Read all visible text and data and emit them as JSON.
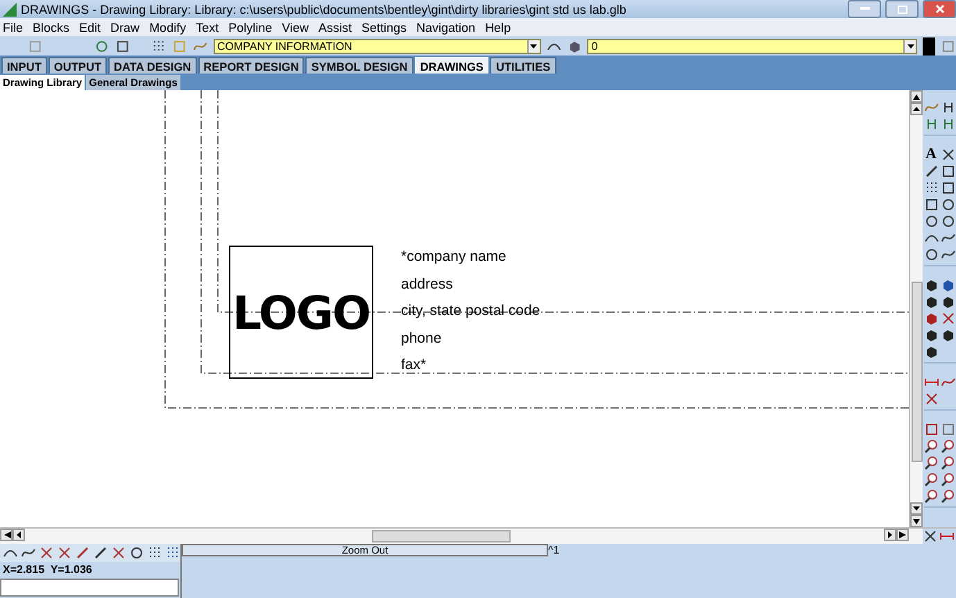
{
  "window": {
    "title": "DRAWINGS -  Drawing Library:  Library: c:\\users\\public\\documents\\bentley\\gint\\dirty libraries\\gint std us lab.glb"
  },
  "menu": [
    "File",
    "Blocks",
    "Edit",
    "Draw",
    "Modify",
    "Text",
    "Polyline",
    "View",
    "Assist",
    "Settings",
    "Navigation",
    "Help"
  ],
  "toolbar": {
    "entity_select": {
      "value": "COMPANY INFORMATION"
    },
    "layer_select": {
      "value": "0"
    }
  },
  "tabs": [
    {
      "label": "INPUT",
      "selected": false
    },
    {
      "label": "OUTPUT",
      "selected": false
    },
    {
      "label": "DATA DESIGN",
      "selected": false
    },
    {
      "label": "REPORT DESIGN",
      "selected": false
    },
    {
      "label": "SYMBOL DESIGN",
      "selected": false
    },
    {
      "label": "DRAWINGS",
      "selected": true
    },
    {
      "label": "UTILITIES",
      "selected": false
    }
  ],
  "subtabs": [
    {
      "label": "Drawing Library",
      "selected": true
    },
    {
      "label": "General Drawings",
      "selected": false
    }
  ],
  "drawing": {
    "logo": "LOGO",
    "lines": [
      "*company name",
      "address",
      "city, state postal code",
      "phone",
      "fax*"
    ]
  },
  "palette": {
    "text_tool": "A"
  },
  "status": {
    "zoom_button": "Zoom Out",
    "page_marker": "^1",
    "coordinates": "X=2.815  Y=1.036"
  }
}
